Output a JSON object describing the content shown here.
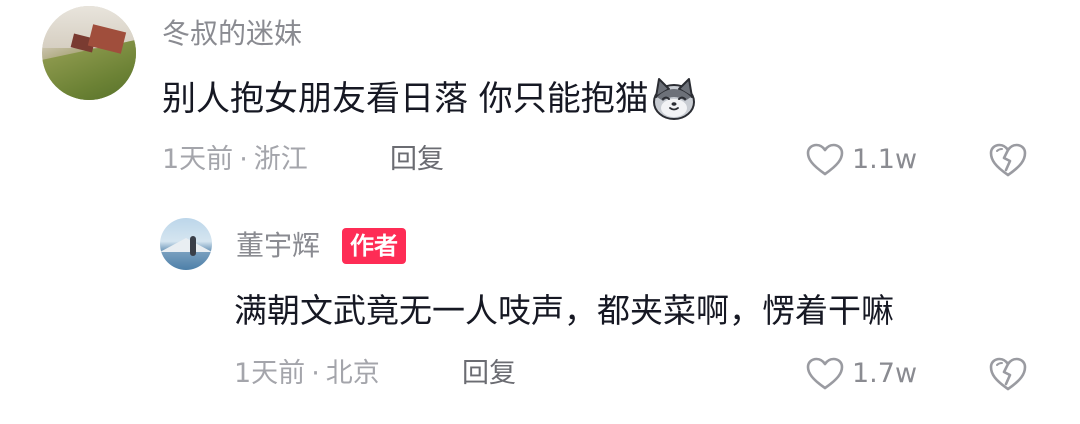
{
  "comment": {
    "username": "冬叔的迷妹",
    "text": "别人抱女朋友看日落 你只能抱猫",
    "emoji": "cat-emoji",
    "time": "1天前",
    "separator": "·",
    "location": "浙江",
    "reply_label": "回复",
    "like_count": "1.1w"
  },
  "reply": {
    "username": "董宇辉",
    "badge": "作者",
    "text": "满朝文武竟无一人吱声，都夹菜啊，愣着干嘛",
    "time": "1天前",
    "separator": "·",
    "location": "北京",
    "reply_label": "回复",
    "like_count": "1.7w"
  },
  "colors": {
    "primary_text": "#161823",
    "secondary_text": "#8a8b91",
    "meta_text": "#a4a5ab",
    "badge_bg": "#fe2c55",
    "icon_stroke": "#9a9ba1"
  },
  "icons": {
    "like": "heart-outline-icon",
    "dislike": "broken-heart-icon"
  }
}
